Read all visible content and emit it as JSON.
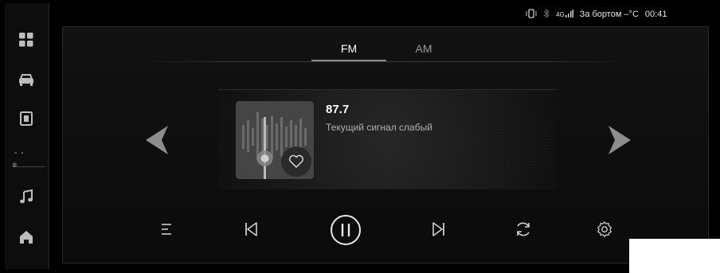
{
  "status_bar": {
    "network": "4G",
    "outside_temp": "За бортом –°C",
    "time": "00:41",
    "icons": [
      "phone-vibrate-icon",
      "bluetooth-icon",
      "signal-bars-icon"
    ]
  },
  "sidebar": {
    "items": [
      {
        "icon": "apps-grid-icon"
      },
      {
        "icon": "car-icon"
      },
      {
        "icon": "phone-book-icon"
      },
      {
        "icon": "climate-fan-icon",
        "text": "- -"
      },
      {
        "icon": "music-note-icon"
      },
      {
        "icon": "home-icon"
      }
    ]
  },
  "radio": {
    "tabs": [
      {
        "label": "FM",
        "active": true
      },
      {
        "label": "AM",
        "active": false
      }
    ],
    "frequency": "87.7",
    "signal_text": "Текущий сигнал слабый"
  },
  "controls": [
    "list-icon",
    "previous-icon",
    "pause-icon",
    "next-icon",
    "scan-icon",
    "settings-icon"
  ],
  "colors": {
    "background": "#000000",
    "panel": "#111111",
    "accent": "#ffffff",
    "muted": "#9a9a9a"
  }
}
